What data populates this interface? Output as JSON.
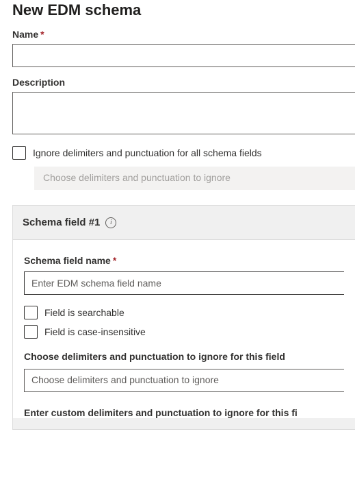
{
  "page": {
    "title": "New EDM schema"
  },
  "fields": {
    "name": {
      "label": "Name",
      "value": ""
    },
    "description": {
      "label": "Description",
      "value": ""
    },
    "ignore_global": {
      "label": "Ignore delimiters and punctuation for all schema fields",
      "dropdown_placeholder": "Choose delimiters and punctuation to ignore"
    }
  },
  "section": {
    "header": "Schema field #1",
    "info_glyph": "i",
    "field_name": {
      "label": "Schema field name",
      "placeholder": "Enter EDM schema field name"
    },
    "checkboxes": {
      "searchable": "Field is searchable",
      "case_insensitive": "Field is case-insensitive"
    },
    "choose_delim": {
      "label": "Choose delimiters and punctuation to ignore for this field",
      "placeholder": "Choose delimiters and punctuation to ignore"
    },
    "custom_delim": {
      "label": "Enter custom delimiters and punctuation to ignore for this fi"
    }
  }
}
